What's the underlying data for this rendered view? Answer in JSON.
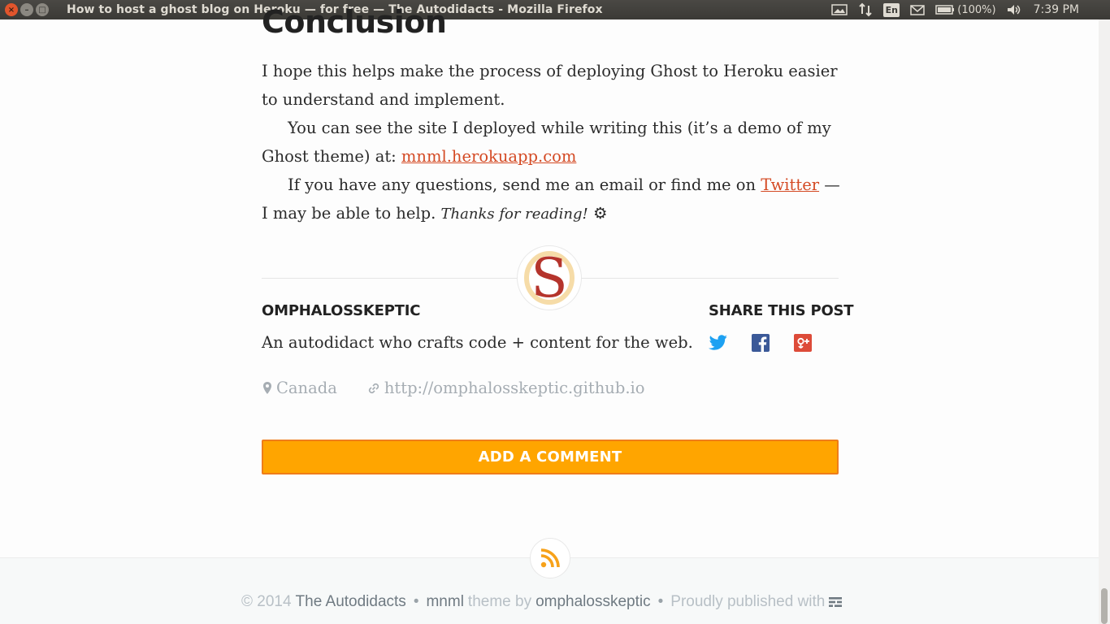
{
  "window": {
    "title": "How to host a ghost blog on Heroku — for free — The Autodidacts - Mozilla Firefox",
    "close_glyph": "×",
    "minimize_glyph": "–",
    "maximize_glyph": "□"
  },
  "system_tray": {
    "keyboard_layout": "En",
    "battery_percent": "(100%)",
    "clock": "7:39 PM"
  },
  "article": {
    "heading": "Conclusion",
    "para1": "I hope this helps make the process of deploying Ghost to Heroku easier to understand and implement.",
    "para2_text": "You can see the site I deployed while writing this (it’s a demo of my Ghost theme) at: ",
    "para2_link": "mnml.herokuapp.com",
    "para3_text": "If you have any questions, send me an email or find me on ",
    "para3_link": "Twitter",
    "para3_after": " — I may be able to help. ",
    "para3_thanks": "Thanks for reading!",
    "para3_glyph": "⚙"
  },
  "author": {
    "avatar_letter": "S",
    "name": "OMPHALOSSKEPTIC",
    "bio": "An autodidact who crafts code + content for the web.",
    "location": "Canada",
    "website": "http://omphalosskeptic.github.io"
  },
  "share": {
    "title": "SHARE THIS POST",
    "icons": [
      "twitter-icon",
      "facebook-icon",
      "google-plus-icon"
    ]
  },
  "comment_button": "ADD A COMMENT",
  "footer": {
    "copyright": "© 2014",
    "site_name": "The Autodidacts",
    "theme_name": "mnml",
    "theme_by": "theme by",
    "theme_author": "omphalosskeptic",
    "published": "Proudly published with"
  },
  "colors": {
    "accent": "#ffa500",
    "link": "#d44a24",
    "twitter": "#1da1f2",
    "facebook": "#3b5998",
    "google_plus": "#dd4b39"
  }
}
